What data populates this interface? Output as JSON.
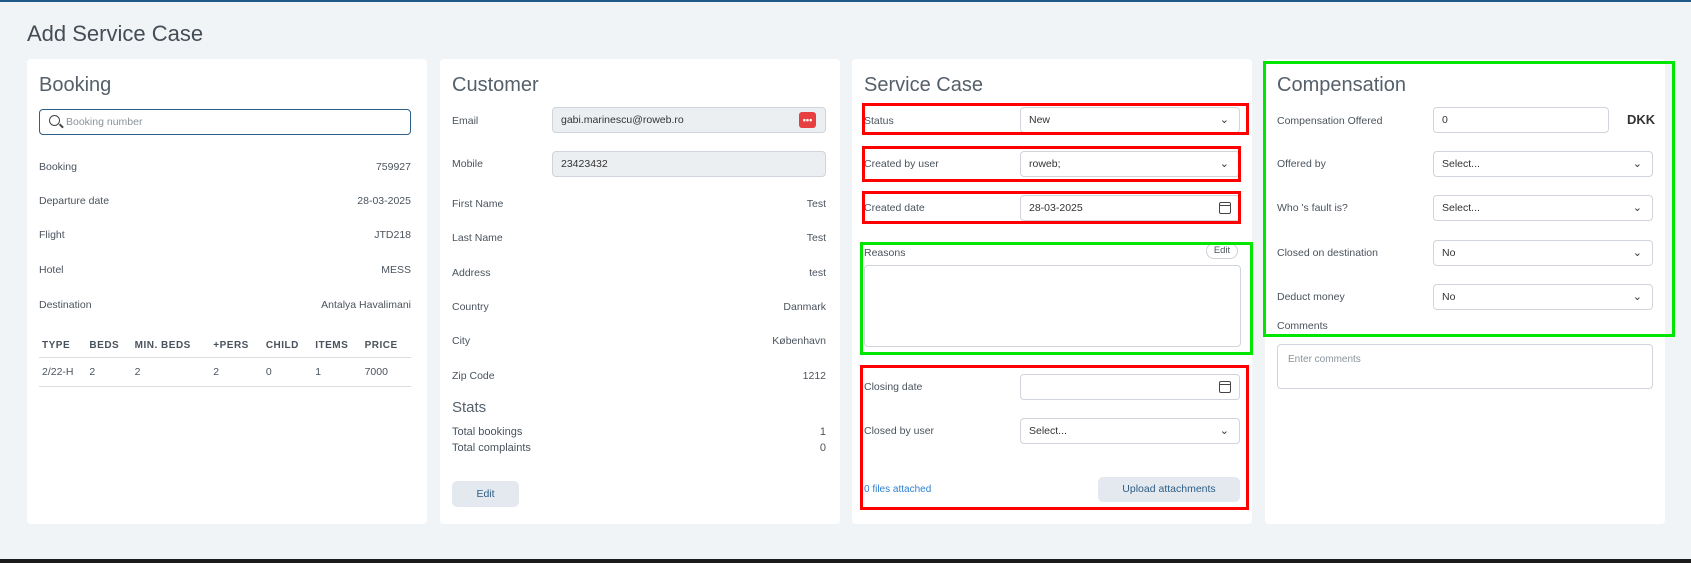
{
  "page": {
    "title": "Add Service Case"
  },
  "booking": {
    "title": "Booking",
    "search_placeholder": "Booking number",
    "fields": [
      {
        "label": "Booking",
        "value": "759927"
      },
      {
        "label": "Departure date",
        "value": "28-03-2025"
      },
      {
        "label": "Flight",
        "value": "JTD218"
      },
      {
        "label": "Hotel",
        "value": "MESS"
      },
      {
        "label": "Destination",
        "value": "Antalya Havalimani"
      }
    ],
    "table": {
      "headers": [
        "TYPE",
        "BEDS",
        "MIN. BEDS",
        "+PERS",
        "CHILD",
        "ITEMS",
        "PRICE"
      ],
      "rows": [
        [
          "2/22-H",
          "2",
          "2",
          "2",
          "0",
          "1",
          "7000"
        ]
      ]
    }
  },
  "customer": {
    "title": "Customer",
    "email_label": "Email",
    "email_value": "gabi.marinescu@roweb.ro",
    "mobile_label": "Mobile",
    "mobile_value": "23423432",
    "fields": [
      {
        "label": "First Name",
        "value": "Test"
      },
      {
        "label": "Last Name",
        "value": "Test"
      },
      {
        "label": "Address",
        "value": "test"
      },
      {
        "label": "Country",
        "value": "Danmark"
      },
      {
        "label": "City",
        "value": "København"
      },
      {
        "label": "Zip Code",
        "value": "1212"
      }
    ],
    "stats_title": "Stats",
    "stats": [
      {
        "label": "Total bookings",
        "value": "1"
      },
      {
        "label": "Total complaints",
        "value": "0"
      }
    ],
    "edit_label": "Edit"
  },
  "service_case": {
    "title": "Service Case",
    "status_label": "Status",
    "status_value": "New",
    "created_by_label": "Created by user",
    "created_by_value": "roweb;",
    "created_date_label": "Created date",
    "created_date_value": "28-03-2025",
    "reasons_label": "Reasons",
    "reasons_edit": "Edit",
    "closing_date_label": "Closing date",
    "closed_by_label": "Closed by user",
    "closed_by_value": "Select...",
    "files_link": "0 files attached",
    "upload_label": "Upload attachments"
  },
  "compensation": {
    "title": "Compensation",
    "offered_label": "Compensation Offered",
    "offered_value": "0",
    "currency": "DKK",
    "offered_by_label": "Offered by",
    "offered_by_value": "Select...",
    "fault_label": "Who 's fault is?",
    "fault_value": "Select...",
    "closed_dest_label": "Closed on destination",
    "closed_dest_value": "No",
    "deduct_label": "Deduct money",
    "deduct_value": "No",
    "comments_label": "Comments",
    "comments_placeholder": "Enter comments"
  },
  "colors": {
    "highlight_red": "#ff0000",
    "highlight_green": "#00e600",
    "accent": "#1f5a8a"
  }
}
